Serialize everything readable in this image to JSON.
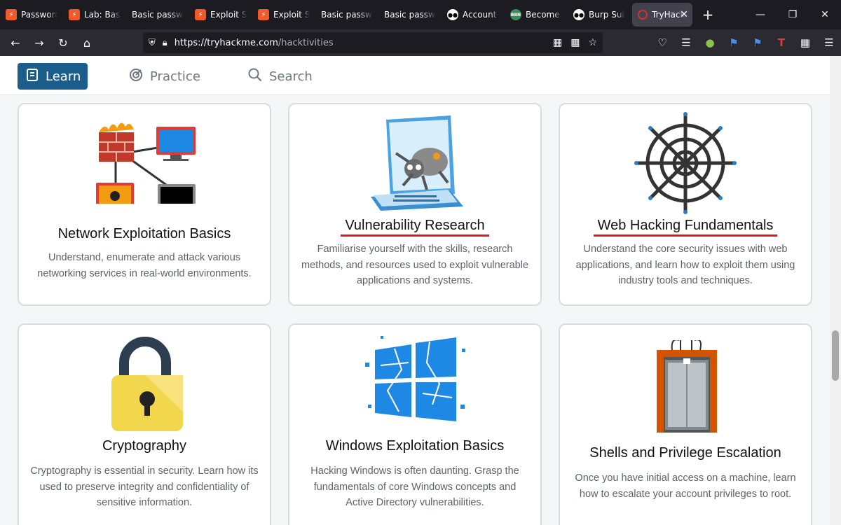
{
  "browser": {
    "tabs": [
      {
        "label": "Password",
        "fav": "thm",
        "fav_text": "⚡"
      },
      {
        "label": "Lab: Basic",
        "fav": "thm",
        "fav_text": "⚡"
      },
      {
        "label": "Basic passwor",
        "fav": "none",
        "fav_text": ""
      },
      {
        "label": "Exploit Se",
        "fav": "thm",
        "fav_text": "⚡"
      },
      {
        "label": "Exploit Se",
        "fav": "thm",
        "fav_text": "⚡"
      },
      {
        "label": "Basic passwor",
        "fav": "none",
        "fav_text": ""
      },
      {
        "label": "Basic passwor",
        "fav": "none",
        "fav_text": ""
      },
      {
        "label": "Account t",
        "fav": "med",
        "fav_text": "●●"
      },
      {
        "label": "Become a",
        "fav": "bbn",
        "fav_text": "BBN"
      },
      {
        "label": "Burp Suite",
        "fav": "med",
        "fav_text": "●●"
      },
      {
        "label": "TryHack",
        "fav": "active",
        "fav_text": ""
      }
    ],
    "close_glyph": "✕",
    "new_tab_glyph": "+",
    "url_host": "https://tryhackme.com",
    "url_path": "/hacktivities"
  },
  "site_nav": {
    "learn": "Learn",
    "practice": "Practice",
    "search": "Search"
  },
  "cards": [
    {
      "title": "Network Exploitation Basics",
      "desc": "Understand, enumerate and attack various networking services in real-world environments.",
      "underlined": false
    },
    {
      "title": "Vulnerability Research",
      "desc": "Familiarise yourself with the skills, research methods, and resources used to exploit vulnerable applications and systems.",
      "underlined": true
    },
    {
      "title": "Web Hacking Fundamentals",
      "desc": "Understand the core security issues with web applications, and learn how to exploit them using industry tools and techniques.",
      "underlined": true
    },
    {
      "title": "Cryptography",
      "desc": "Cryptography is essential in security. Learn how its used to preserve integrity and confidentiality of sensitive information.",
      "underlined": false
    },
    {
      "title": "Windows Exploitation Basics",
      "desc": "Hacking Windows is often daunting. Grasp the fundamentals of core Windows concepts and Active Directory vulnerabilities.",
      "underlined": false
    },
    {
      "title": "Shells and Privilege Escalation",
      "desc": "Once you have initial access on a machine, learn how to escalate your account privileges to root.",
      "underlined": false
    }
  ],
  "colors": {
    "learn_button": "#1b5e8c",
    "underline": "#d8192a",
    "tryhackme_orange": "#f05a28"
  }
}
